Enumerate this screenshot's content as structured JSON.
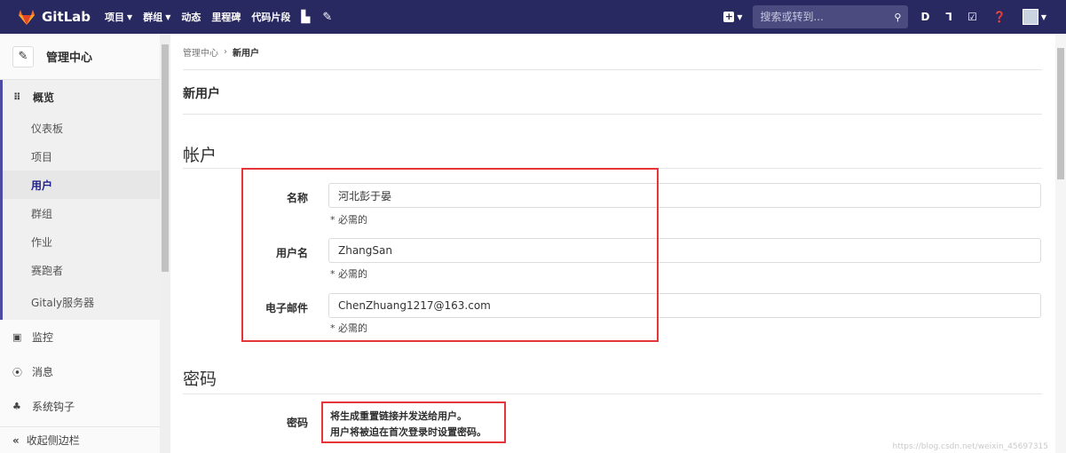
{
  "navbar": {
    "brand": "GitLab",
    "links": [
      {
        "label": "项目",
        "caret": true
      },
      {
        "label": "群组",
        "caret": true
      },
      {
        "label": "动态",
        "caret": false
      },
      {
        "label": "里程碑",
        "caret": false
      },
      {
        "label": "代码片段",
        "caret": false
      }
    ],
    "search_placeholder": "搜索或转到...",
    "brand_color": "#292961"
  },
  "sidebar": {
    "title": "管理中心",
    "overview": "概览",
    "sub_items": [
      "仪表板",
      "项目",
      "用户",
      "群组",
      "作业",
      "赛跑者",
      "Gitaly服务器"
    ],
    "active_sub": "用户",
    "items": [
      "监控",
      "消息",
      "系统钩子"
    ],
    "collapse": "收起侧边栏"
  },
  "breadcrumb": {
    "parent": "管理中心",
    "current": "新用户"
  },
  "page": {
    "title": "新用户"
  },
  "account": {
    "section_title": "帐户",
    "fields": [
      {
        "label": "名称",
        "value": "河北彭于晏",
        "hint": "* 必需的"
      },
      {
        "label": "用户名",
        "value": "ZhangSan",
        "hint": "* 必需的"
      },
      {
        "label": "电子邮件",
        "value": "ChenZhuang1217@163.com",
        "hint": "* 必需的"
      }
    ]
  },
  "password": {
    "section_title": "密码",
    "label": "密码",
    "note_line1": "将生成重置链接并发送给用户。",
    "note_line2": "用户将被迫在首次登录时设置密码。"
  },
  "watermark": "https://blog.csdn.net/weixin_45697315",
  "colors": {
    "highlight": "#e5353b",
    "active_nav": "#1f1f8f"
  }
}
